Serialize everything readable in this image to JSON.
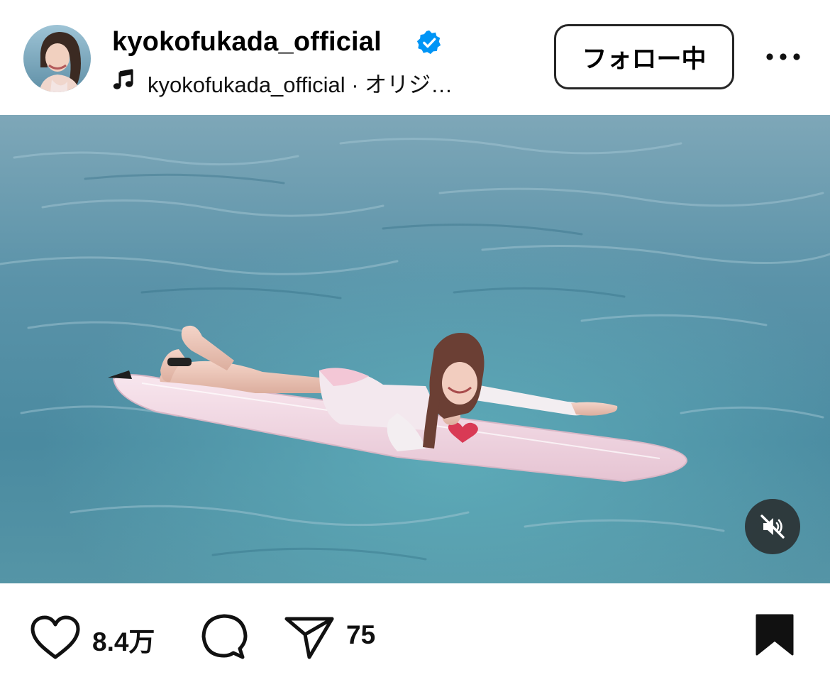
{
  "post": {
    "username": "kyokofukada_official",
    "verified": true,
    "audio": "kyokofukada_official · オリジ…",
    "follow_label": "フォロー中",
    "media_description": "",
    "muted": true
  },
  "actions": {
    "like_count": "8.4万",
    "share_count": "75",
    "saved": true
  },
  "colors": {
    "verified_blue": "#0095f6",
    "text": "#000000",
    "border": "#262626",
    "sea": "#5f99ad",
    "board": "#f3dbe6"
  },
  "icons": [
    "verified-badge-icon",
    "music-note-icon",
    "more-options-icon",
    "muted-speaker-icon",
    "heart-icon",
    "comment-icon",
    "send-icon",
    "bookmark-icon"
  ]
}
